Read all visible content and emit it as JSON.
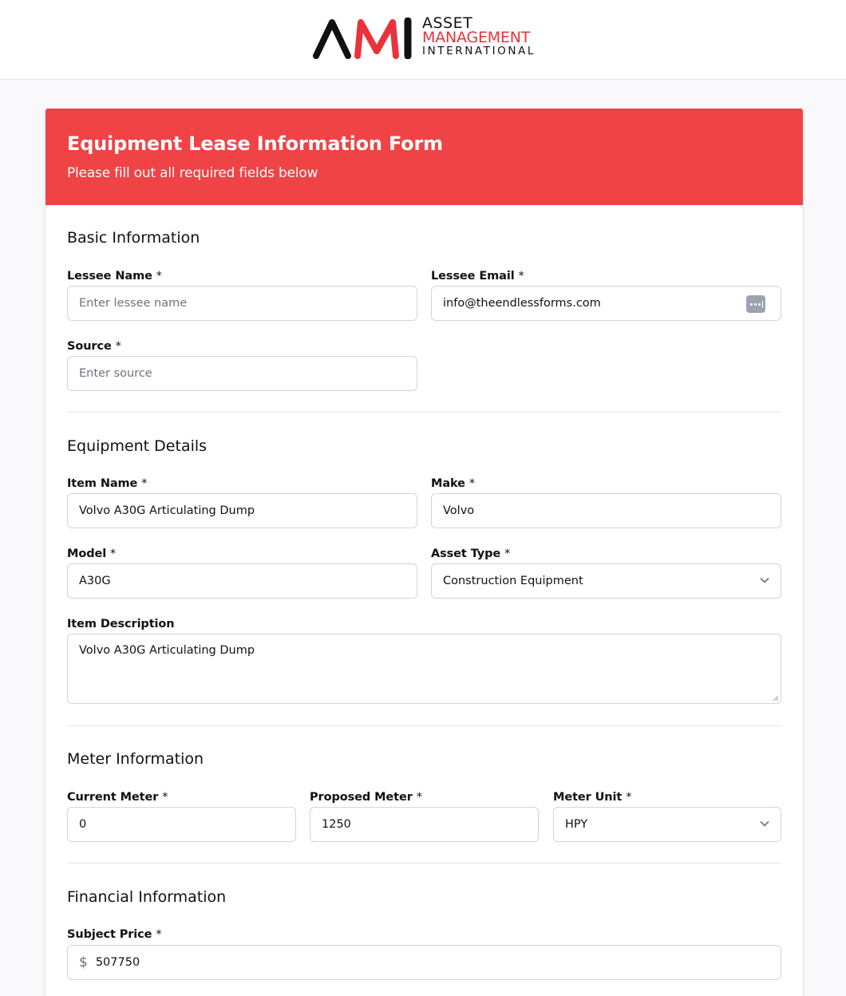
{
  "brand": {
    "mark": "AMI",
    "line1": "ASSET",
    "line2": "MANAGEMENT",
    "line3": "INTERNATIONAL",
    "accent_color": "#ef4346"
  },
  "form": {
    "title": "Equipment Lease Information Form",
    "subtitle": "Please fill out all required fields below"
  },
  "basic": {
    "title": "Basic Information",
    "lessee_name": {
      "label": "Lessee Name",
      "placeholder": "Enter lessee name",
      "value": ""
    },
    "lessee_email": {
      "label": "Lessee Email",
      "value": "info@theendlessforms.com"
    },
    "source": {
      "label": "Source",
      "placeholder": "Enter source",
      "value": ""
    }
  },
  "equipment": {
    "title": "Equipment Details",
    "item_name": {
      "label": "Item Name",
      "value": "Volvo A30G Articulating Dump"
    },
    "make": {
      "label": "Make",
      "value": "Volvo"
    },
    "model": {
      "label": "Model",
      "value": "A30G"
    },
    "asset_type": {
      "label": "Asset Type",
      "value": "Construction Equipment"
    },
    "description": {
      "label": "Item Description",
      "value": "Volvo A30G Articulating Dump"
    }
  },
  "meter": {
    "title": "Meter Information",
    "current": {
      "label": "Current Meter",
      "value": "0"
    },
    "proposed": {
      "label": "Proposed Meter",
      "value": "1250"
    },
    "unit": {
      "label": "Meter Unit",
      "value": "HPY"
    }
  },
  "financial": {
    "title": "Financial Information",
    "subject_price": {
      "label": "Subject Price",
      "currency": "$",
      "value": "507750"
    }
  },
  "required_marker": "*",
  "icons": [
    "password-manager-icon",
    "chevron-down-icon",
    "resize-handle-icon"
  ]
}
